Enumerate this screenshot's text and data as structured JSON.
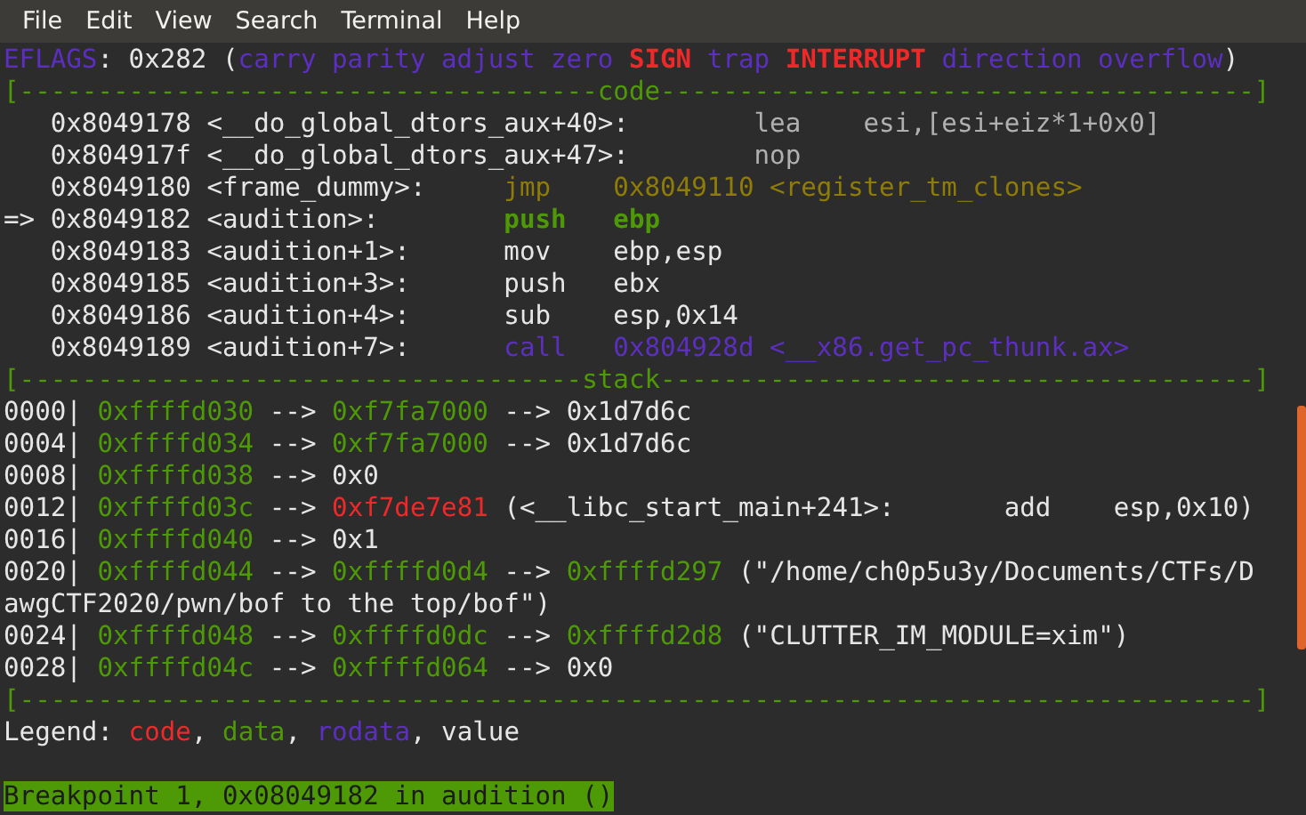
{
  "menu": [
    {
      "label": "File"
    },
    {
      "label": "Edit"
    },
    {
      "label": "View"
    },
    {
      "label": "Search"
    },
    {
      "label": "Terminal"
    },
    {
      "label": "Help"
    }
  ],
  "lines": [
    {
      "segments": [
        {
          "text": "EFLAGS",
          "kind": "rodata"
        },
        {
          "text": ": 0x282 (",
          "kind": "plain"
        },
        {
          "text": "carry parity adjust zero ",
          "kind": "rodata"
        },
        {
          "text": "SIGN",
          "kind": "alert"
        },
        {
          "text": " trap ",
          "kind": "rodata"
        },
        {
          "text": "INTERRUPT",
          "kind": "alert"
        },
        {
          "text": " direction overflow",
          "kind": "rodata"
        },
        {
          "text": ")",
          "kind": "plain"
        }
      ]
    },
    {
      "segments": [
        {
          "text": "[-------------------------------------code--------------------------------------]",
          "kind": "rule"
        }
      ]
    },
    {
      "segments": [
        {
          "text": "   0x8049178 <__do_global_dtors_aux+40>:        ",
          "kind": "plain"
        },
        {
          "text": "lea    esi,[esi+eiz*1+0x0]",
          "kind": "dim"
        }
      ]
    },
    {
      "segments": [
        {
          "text": "   0x804917f <__do_global_dtors_aux+47>:        ",
          "kind": "plain"
        },
        {
          "text": "nop",
          "kind": "dim"
        }
      ]
    },
    {
      "segments": [
        {
          "text": "   0x8049180 <frame_dummy>:     ",
          "kind": "plain"
        },
        {
          "text": "jmp    0x8049110 <register_tm_clones>",
          "kind": "branch"
        }
      ]
    },
    {
      "segments": [
        {
          "text": "=> 0x8049182 <audition>:        ",
          "kind": "plain"
        },
        {
          "text": "push   ebp",
          "kind": "current"
        }
      ]
    },
    {
      "segments": [
        {
          "text": "   0x8049183 <audition+1>:      mov    ebp,esp",
          "kind": "plain"
        }
      ]
    },
    {
      "segments": [
        {
          "text": "   0x8049185 <audition+3>:      push   ebx",
          "kind": "plain"
        }
      ]
    },
    {
      "segments": [
        {
          "text": "   0x8049186 <audition+4>:      sub    esp,0x14",
          "kind": "plain"
        }
      ]
    },
    {
      "segments": [
        {
          "text": "   0x8049189 <audition+7>:      ",
          "kind": "plain"
        },
        {
          "text": "call   0x804928d <__x86.get_pc_thunk.ax>",
          "kind": "rodata"
        }
      ]
    },
    {
      "segments": [
        {
          "text": "[------------------------------------stack--------------------------------------]",
          "kind": "rule"
        }
      ]
    },
    {
      "segments": [
        {
          "text": "0000| ",
          "kind": "plain"
        },
        {
          "text": "0xffffd030",
          "kind": "data"
        },
        {
          "text": " --> ",
          "kind": "plain"
        },
        {
          "text": "0xf7fa7000",
          "kind": "data"
        },
        {
          "text": " --> 0x1d7d6c",
          "kind": "plain"
        }
      ]
    },
    {
      "segments": [
        {
          "text": "0004| ",
          "kind": "plain"
        },
        {
          "text": "0xffffd034",
          "kind": "data"
        },
        {
          "text": " --> ",
          "kind": "plain"
        },
        {
          "text": "0xf7fa7000",
          "kind": "data"
        },
        {
          "text": " --> 0x1d7d6c",
          "kind": "plain"
        }
      ]
    },
    {
      "segments": [
        {
          "text": "0008| ",
          "kind": "plain"
        },
        {
          "text": "0xffffd038",
          "kind": "data"
        },
        {
          "text": " --> 0x0",
          "kind": "plain"
        }
      ]
    },
    {
      "segments": [
        {
          "text": "0012| ",
          "kind": "plain"
        },
        {
          "text": "0xffffd03c",
          "kind": "data"
        },
        {
          "text": " --> ",
          "kind": "plain"
        },
        {
          "text": "0xf7de7e81",
          "kind": "code"
        },
        {
          "text": " (<__libc_start_main+241>:       add    esp,0x10)",
          "kind": "plain"
        }
      ]
    },
    {
      "segments": [
        {
          "text": "0016| ",
          "kind": "plain"
        },
        {
          "text": "0xffffd040",
          "kind": "data"
        },
        {
          "text": " --> 0x1",
          "kind": "plain"
        }
      ]
    },
    {
      "segments": [
        {
          "text": "0020| ",
          "kind": "plain"
        },
        {
          "text": "0xffffd044",
          "kind": "data"
        },
        {
          "text": " --> ",
          "kind": "plain"
        },
        {
          "text": "0xffffd0d4",
          "kind": "data"
        },
        {
          "text": " --> ",
          "kind": "plain"
        },
        {
          "text": "0xffffd297",
          "kind": "data"
        },
        {
          "text": " (\"/home/ch0p5u3y/Documents/CTFs/D",
          "kind": "plain"
        }
      ]
    },
    {
      "segments": [
        {
          "text": "awgCTF2020/pwn/bof to the top/bof\")",
          "kind": "plain"
        }
      ]
    },
    {
      "segments": [
        {
          "text": "0024| ",
          "kind": "plain"
        },
        {
          "text": "0xffffd048",
          "kind": "data"
        },
        {
          "text": " --> ",
          "kind": "plain"
        },
        {
          "text": "0xffffd0dc",
          "kind": "data"
        },
        {
          "text": " --> ",
          "kind": "plain"
        },
        {
          "text": "0xffffd2d8",
          "kind": "data"
        },
        {
          "text": " (\"CLUTTER_IM_MODULE=xim\")",
          "kind": "plain"
        }
      ]
    },
    {
      "segments": [
        {
          "text": "0028| ",
          "kind": "plain"
        },
        {
          "text": "0xffffd04c",
          "kind": "data"
        },
        {
          "text": " --> ",
          "kind": "plain"
        },
        {
          "text": "0xffffd064",
          "kind": "data"
        },
        {
          "text": " --> 0x0",
          "kind": "plain"
        }
      ]
    },
    {
      "segments": [
        {
          "text": "[-------------------------------------------------------------------------------]",
          "kind": "rule"
        }
      ]
    },
    {
      "segments": [
        {
          "text": "Legend: ",
          "kind": "plain"
        },
        {
          "text": "code",
          "kind": "code"
        },
        {
          "text": ", ",
          "kind": "plain"
        },
        {
          "text": "data",
          "kind": "data"
        },
        {
          "text": ", ",
          "kind": "plain"
        },
        {
          "text": "rodata",
          "kind": "rodata"
        },
        {
          "text": ", value",
          "kind": "plain"
        }
      ]
    },
    {
      "segments": [
        {
          "text": "Breakpoint 1, 0x08049182 in audition ()",
          "kind": "highlight"
        }
      ]
    }
  ]
}
